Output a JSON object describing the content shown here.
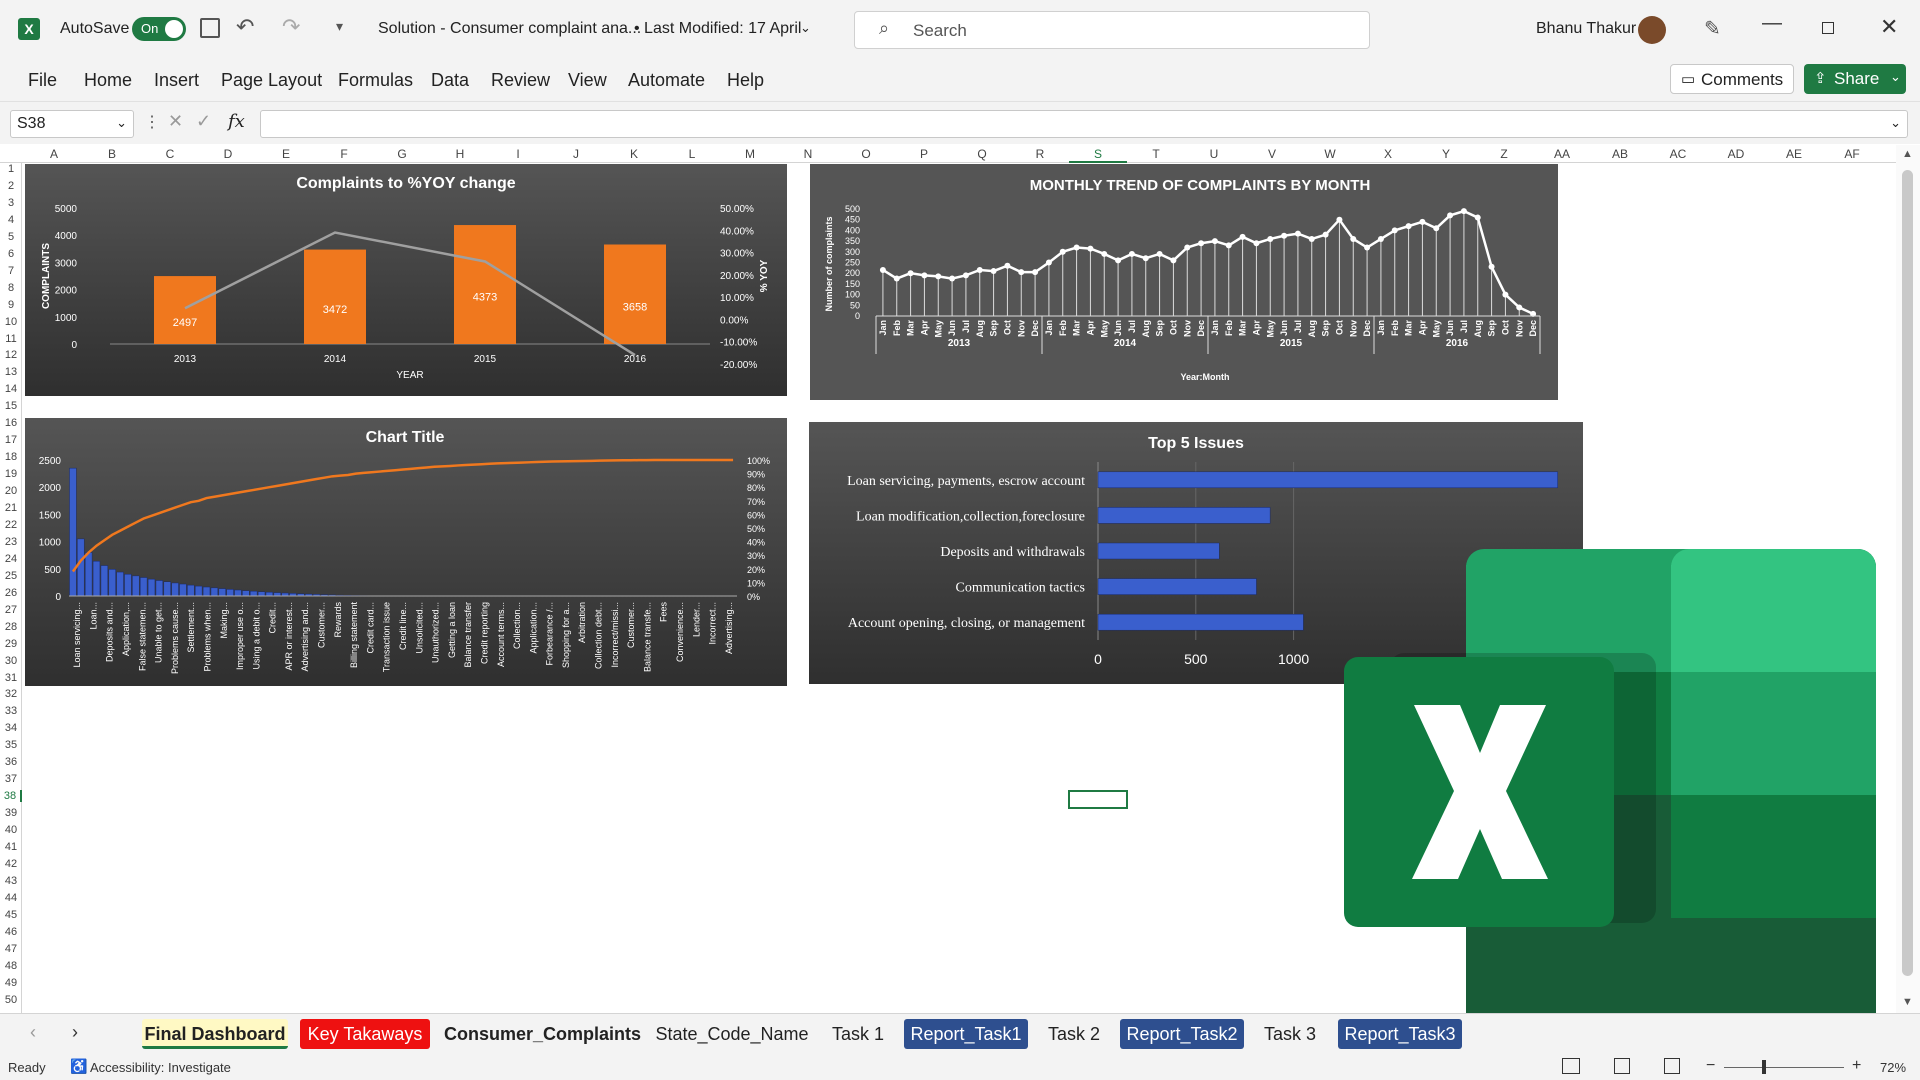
{
  "titlebar": {
    "autosave_label": "AutoSave",
    "autosave_state": "On",
    "doc_title": "Solution - Consumer complaint ana...",
    "last_modified": "• Last Modified: 17 April",
    "search_placeholder": "Search",
    "user_name": "Bhanu Thakur"
  },
  "menu": [
    "File",
    "Home",
    "Insert",
    "Page Layout",
    "Formulas",
    "Data",
    "Review",
    "View",
    "Automate",
    "Help"
  ],
  "buttons": {
    "comments": "Comments",
    "share": "Share"
  },
  "formula_bar": {
    "cell_ref": "S38",
    "fx": "fx",
    "value": ""
  },
  "columns": [
    "A",
    "B",
    "C",
    "D",
    "E",
    "F",
    "G",
    "H",
    "I",
    "J",
    "K",
    "L",
    "M",
    "N",
    "O",
    "P",
    "Q",
    "R",
    "S",
    "T",
    "U",
    "V",
    "W",
    "X",
    "Y",
    "Z",
    "AA",
    "AB",
    "AC",
    "AD",
    "AE",
    "AF"
  ],
  "rows": [
    "1",
    "2",
    "3",
    "4",
    "5",
    "6",
    "7",
    "8",
    "9",
    "10",
    "11",
    "12",
    "13",
    "14",
    "15",
    "16",
    "17",
    "18",
    "19",
    "20",
    "21",
    "22",
    "23",
    "24",
    "25",
    "26",
    "27",
    "28",
    "29",
    "30",
    "31",
    "32",
    "33",
    "34",
    "35",
    "36",
    "37",
    "38",
    "39",
    "40",
    "41",
    "42",
    "43",
    "44",
    "45",
    "46",
    "47",
    "48",
    "49",
    "50"
  ],
  "chart_data": [
    {
      "id": "yoy",
      "type": "bar",
      "title": "Complaints to %YOY change",
      "xlabel": "YEAR",
      "ylabel": "COMPLAINTS",
      "y2label": "% YOY",
      "categories": [
        "2013",
        "2014",
        "2015",
        "2016"
      ],
      "series": [
        {
          "values": [
            2497,
            3472,
            4373,
            3658
          ]
        },
        {
          "type": "line",
          "values": [
            5,
            39,
            26,
            -16
          ]
        }
      ],
      "ylim": [
        0,
        5000
      ],
      "yticks": [
        "5000",
        "4000",
        "3000",
        "2000",
        "1000",
        "0"
      ],
      "y2ticks": [
        "50.00%",
        "40.00%",
        "30.00%",
        "20.00%",
        "10.00%",
        "0.00%",
        "-10.00%",
        "-20.00%"
      ]
    },
    {
      "id": "monthly",
      "type": "line",
      "title": "MONTHLY TREND OF COMPLAINTS BY MONTH",
      "xlabel": "Year:Month",
      "ylabel": "Number of complaints",
      "years": [
        "2013",
        "2014",
        "2015",
        "2016"
      ],
      "months": [
        "Jan",
        "Feb",
        "Mar",
        "Apr",
        "May",
        "Jun",
        "Jul",
        "Aug",
        "Sep",
        "Oct",
        "Nov",
        "Dec"
      ],
      "values": [
        215,
        175,
        200,
        190,
        185,
        175,
        190,
        215,
        210,
        235,
        205,
        205,
        250,
        300,
        320,
        315,
        290,
        260,
        290,
        270,
        290,
        260,
        320,
        340,
        350,
        330,
        370,
        340,
        360,
        375,
        385,
        360,
        380,
        450,
        360,
        320,
        360,
        400,
        420,
        440,
        410,
        470,
        490,
        460,
        230,
        100,
        40,
        10
      ],
      "ylim": [
        0,
        500
      ],
      "yticks": [
        "500",
        "450",
        "400",
        "350",
        "300",
        "250",
        "200",
        "150",
        "100",
        "50",
        "0"
      ]
    },
    {
      "id": "pareto",
      "type": "bar",
      "title": "Chart Title",
      "yticks": [
        "2500",
        "2000",
        "1500",
        "1000",
        "500",
        "0"
      ],
      "y2ticks": [
        "100%",
        "90%",
        "80%",
        "70%",
        "60%",
        "50%",
        "40%",
        "30%",
        "20%",
        "10%",
        "0%"
      ],
      "ylim": [
        0,
        2500
      ],
      "categories": [
        "Loan servicing...",
        "Loan...",
        "Deposits and...",
        "Application,...",
        "False statemen...",
        "Unable to get...",
        "Problems cause...",
        "Settlement...",
        "Problems when...",
        "Making...",
        "Improper use o...",
        "Using a debit o...",
        "Credit...",
        "APR or interest...",
        "Advertising and...",
        "Customer...",
        "Rewards",
        "Billing statement",
        "Credit card...",
        "Transaction issue",
        "Credit line...",
        "Unsolicited...",
        "Unauthorized...",
        "Getting a loan",
        "Balance transfer",
        "Credit reporting",
        "Account terms...",
        "Collection...",
        "Application...",
        "Forbearance /...",
        "Shopping for a...",
        "Arbitration",
        "Collection debt...",
        "Incorrect/missi...",
        "Customer...",
        "Balance transfe...",
        "Fees",
        "Convenience...",
        "Lender...",
        "Incorrect...",
        "Advertising..."
      ],
      "values": [
        2350,
        1050,
        800,
        640,
        560,
        490,
        440,
        400,
        370,
        340,
        310,
        285,
        262,
        240,
        220,
        200,
        182,
        165,
        150,
        136,
        122,
        110,
        98,
        88,
        78,
        70,
        62,
        55,
        48,
        42,
        36,
        30,
        25,
        20,
        16,
        12,
        9,
        6,
        4,
        3,
        2,
        2,
        1,
        1,
        1,
        1,
        1,
        1,
        1,
        1,
        1,
        1,
        1,
        1,
        1,
        1,
        1,
        1,
        1,
        1,
        1,
        1,
        1,
        1,
        1,
        1,
        1,
        1,
        1,
        1,
        1,
        1,
        1,
        1,
        1,
        1,
        1,
        1,
        1,
        1,
        1,
        1,
        1,
        1,
        1
      ],
      "cumulative": [
        0.18,
        0.26,
        0.32,
        0.37,
        0.41,
        0.45,
        0.48,
        0.51,
        0.54,
        0.57,
        0.59,
        0.61,
        0.63,
        0.65,
        0.67,
        0.69,
        0.7,
        0.72,
        0.73,
        0.74,
        0.75,
        0.76,
        0.77,
        0.78,
        0.79,
        0.8,
        0.81,
        0.82,
        0.83,
        0.84,
        0.85,
        0.86,
        0.87,
        0.88,
        0.885,
        0.89,
        0.9,
        0.905,
        0.91,
        0.915,
        0.92,
        0.925,
        0.93,
        0.935,
        0.94,
        0.945,
        0.95,
        0.953,
        0.956,
        0.96,
        0.963,
        0.966,
        0.969,
        0.972,
        0.975,
        0.977,
        0.979,
        0.981,
        0.983,
        0.985,
        0.987,
        0.989,
        0.99,
        0.991,
        0.992,
        0.993,
        0.994,
        0.995,
        0.996,
        0.997,
        0.998,
        0.998,
        0.999,
        0.999,
        1,
        1,
        1,
        1,
        1,
        1,
        1,
        1,
        1,
        1,
        1
      ]
    },
    {
      "id": "top5",
      "type": "bar",
      "orientation": "horizontal",
      "title": "Top 5 Issues",
      "categories": [
        "Loan servicing, payments, escrow account",
        "Loan modification,collection,foreclosure",
        "Deposits and withdrawals",
        "Communication tactics",
        "Account opening, closing, or management"
      ],
      "values": [
        2350,
        880,
        620,
        810,
        1050
      ],
      "xticks": [
        "0",
        "500",
        "1000"
      ],
      "xlim": [
        0,
        2500
      ]
    }
  ],
  "sheet_tabs": [
    {
      "label": "Final Dashboard"
    },
    {
      "label": "Key Takaways"
    },
    {
      "label": "Consumer_Complaints"
    },
    {
      "label": "State_Code_Name"
    },
    {
      "label": "Task 1"
    },
    {
      "label": "Report_Task1"
    },
    {
      "label": "Task 2"
    },
    {
      "label": "Report_Task2"
    },
    {
      "label": "Task 3"
    },
    {
      "label": "Report_Task3"
    }
  ],
  "status": {
    "ready": "Ready",
    "accessibility": "Accessibility: Investigate",
    "zoom": "72%"
  },
  "colors": {
    "excel_green": "#1f7a43",
    "bar_orange": "#f0781e",
    "bar_blue": "#3a5fcd",
    "tab_red": "#ee1111",
    "tab_blue": "#2e4f8f",
    "tab_active": "#fff9c4"
  }
}
